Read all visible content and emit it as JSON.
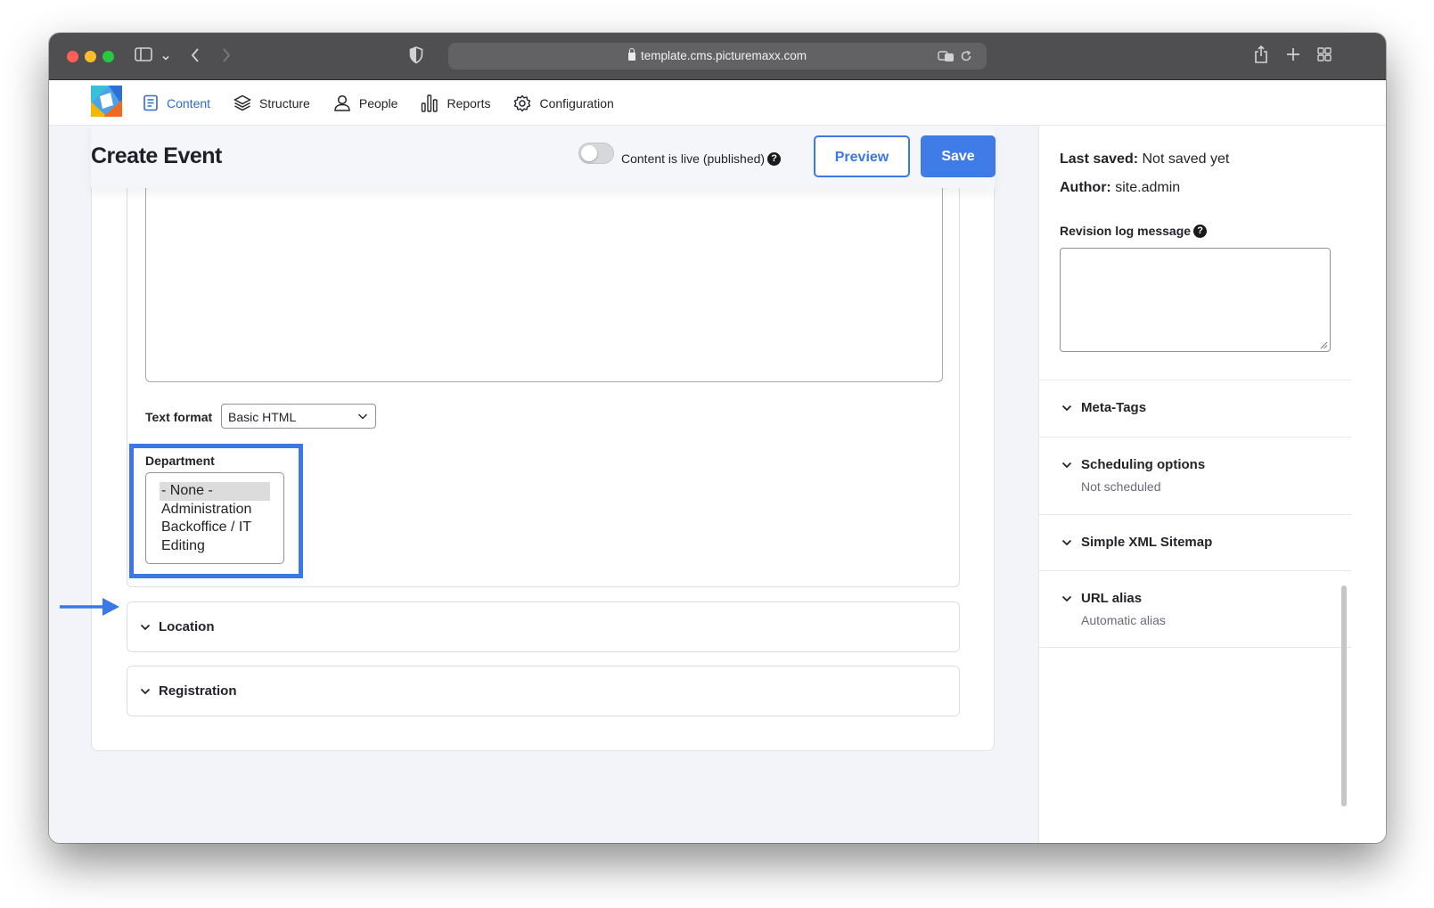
{
  "browser": {
    "url": "template.cms.picturemaxx.com"
  },
  "nav": {
    "items": [
      {
        "label": "Content",
        "icon": "document-icon",
        "active": true
      },
      {
        "label": "Structure",
        "icon": "layers-icon",
        "active": false
      },
      {
        "label": "People",
        "icon": "person-icon",
        "active": false
      },
      {
        "label": "Reports",
        "icon": "bar-chart-icon",
        "active": false
      },
      {
        "label": "Configuration",
        "icon": "gear-icon",
        "active": false
      }
    ]
  },
  "page": {
    "title": "Create Event",
    "toggle_label": "Content is live (published)",
    "help_glyph": "?",
    "preview_label": "Preview",
    "save_label": "Save"
  },
  "form": {
    "text_format_label": "Text format",
    "text_format_value": "Basic HTML",
    "department_label": "Department",
    "department_options": [
      "- None -",
      "Administration",
      "Backoffice / IT",
      "Editing"
    ],
    "department_selected": "- None -",
    "location_label": "Location",
    "registration_label": "Registration"
  },
  "sidebar": {
    "last_saved_label": "Last saved:",
    "last_saved_value": "Not saved yet",
    "author_label": "Author:",
    "author_value": "site.admin",
    "revision_label": "Revision log message",
    "sections": [
      {
        "title": "Meta-Tags",
        "subtitle": ""
      },
      {
        "title": "Scheduling options",
        "subtitle": "Not scheduled"
      },
      {
        "title": "Simple XML Sitemap",
        "subtitle": ""
      },
      {
        "title": "URL alias",
        "subtitle": "Automatic alias"
      }
    ]
  },
  "colors": {
    "accent": "#3f7ce8",
    "highlight_border": "#3a78e6",
    "nav_active": "#2e6ad6"
  }
}
